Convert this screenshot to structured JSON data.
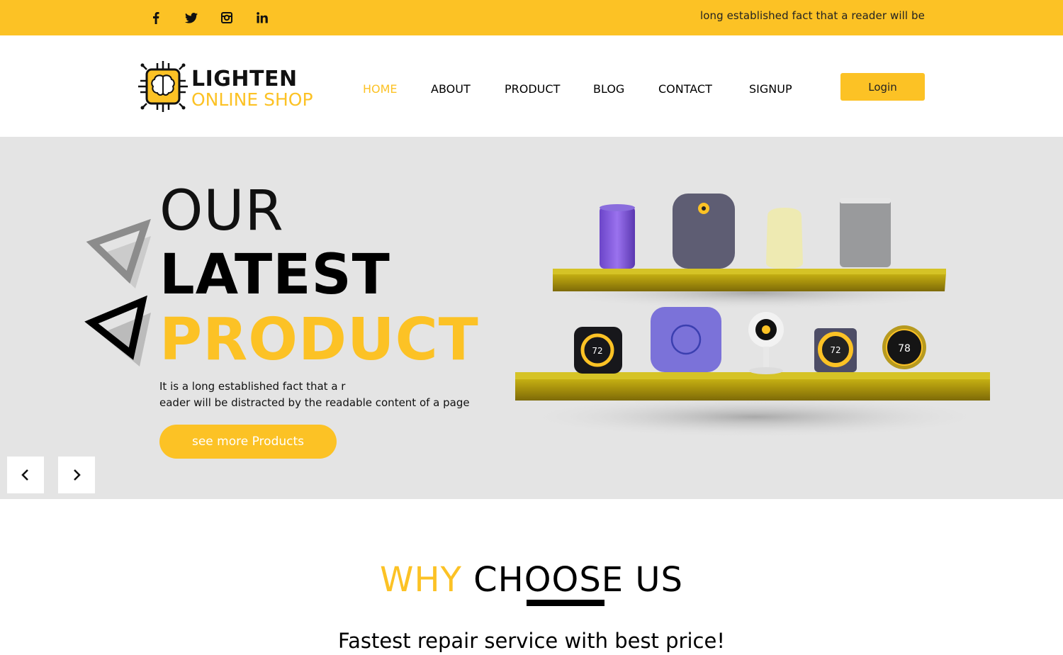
{
  "topbar": {
    "social_icons": [
      "facebook-icon",
      "twitter-icon",
      "instagram-icon",
      "linkedin-icon"
    ],
    "text": "long established fact that a reader will be"
  },
  "header": {
    "logo": {
      "title": "LIGHTEN",
      "subtitle": "ONLINE SHOP",
      "icon": "chip-brain-icon"
    },
    "nav": [
      {
        "label": "HOME",
        "active": true
      },
      {
        "label": "ABOUT",
        "active": false
      },
      {
        "label": "PRODUCT",
        "active": false
      },
      {
        "label": "BLOG",
        "active": false
      },
      {
        "label": "CONTACT",
        "active": false
      },
      {
        "label": "SIGNUP",
        "active": false
      }
    ],
    "login_label": "Login"
  },
  "hero": {
    "line1": "OUR",
    "line2": "LATEST",
    "line3": "PRODUCT",
    "desc_line1": "It is a long established fact that a r",
    "desc_line2": "eader will be distracted by the readable content of a page",
    "button_label": "see more Products",
    "prev_icon": "chevron-left-icon",
    "next_icon": "chevron-right-icon",
    "thermostat_readings": [
      "72",
      "72",
      "78"
    ]
  },
  "why": {
    "title_highlight": "WHY",
    "title_rest": "CHOOSE US",
    "subtitle": "Fastest repair service with best price!"
  },
  "colors": {
    "accent": "#fcc225",
    "hero_bg": "#e4e4e4",
    "text_dark": "#000000"
  }
}
